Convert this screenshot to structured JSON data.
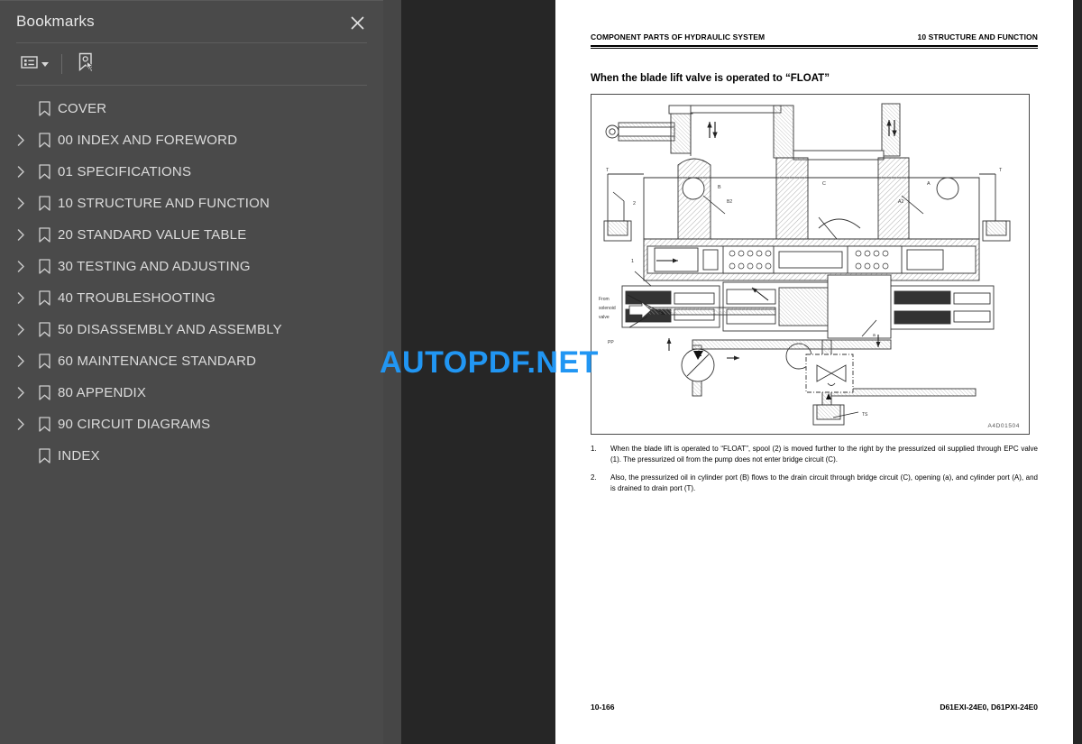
{
  "panel": {
    "title": "Bookmarks",
    "close_icon": "close-icon",
    "toolbar": {
      "options_icon": "list-options-icon",
      "options_caret": "chevron-down-icon",
      "new_bookmark_icon": "new-bookmark-icon"
    },
    "items": [
      {
        "label": "COVER",
        "expandable": false
      },
      {
        "label": "00 INDEX AND FOREWORD",
        "expandable": true
      },
      {
        "label": "01 SPECIFICATIONS",
        "expandable": true
      },
      {
        "label": "10 STRUCTURE AND FUNCTION",
        "expandable": true
      },
      {
        "label": "20 STANDARD VALUE TABLE",
        "expandable": true
      },
      {
        "label": "30 TESTING AND ADJUSTING",
        "expandable": true
      },
      {
        "label": "40 TROUBLESHOOTING",
        "expandable": true
      },
      {
        "label": "50 DISASSEMBLY AND ASSEMBLY",
        "expandable": true
      },
      {
        "label": "60 MAINTENANCE STANDARD",
        "expandable": true
      },
      {
        "label": "80 APPENDIX",
        "expandable": true
      },
      {
        "label": "90 CIRCUIT DIAGRAMS",
        "expandable": true
      },
      {
        "label": "INDEX",
        "expandable": false
      }
    ]
  },
  "document": {
    "header_left": "COMPONENT PARTS OF HYDRAULIC SYSTEM",
    "header_right": "10 STRUCTURE AND FUNCTION",
    "subtitle": "When the blade lift valve is operated to “FLOAT”",
    "figure": {
      "id": "A4D01504",
      "caption_from": "From\nsolenoid\nvalve",
      "labels": [
        "1",
        "2",
        "B",
        "B2",
        "C",
        "A",
        "A2",
        "T",
        "T",
        "PP",
        "a",
        "TS"
      ]
    },
    "paragraphs": [
      {
        "num": "1.",
        "text": "When the blade lift is operated to “FLOAT”, spool (2) is moved further to the right by the pressurized oil supplied through EPC valve (1). The pressurized oil from the pump does not enter bridge circuit (C)."
      },
      {
        "num": "2.",
        "text": "Also, the pressurized oil in cylinder port (B) flows to the drain circuit through bridge circuit (C), opening (a), and cylinder port (A), and is drained to drain port (T)."
      }
    ],
    "footer_left": "10-166",
    "footer_right": "D61EXI-24E0, D61PXI-24E0"
  },
  "watermark": {
    "text": "AUTOPDF.NET",
    "color": "#2196f3"
  }
}
